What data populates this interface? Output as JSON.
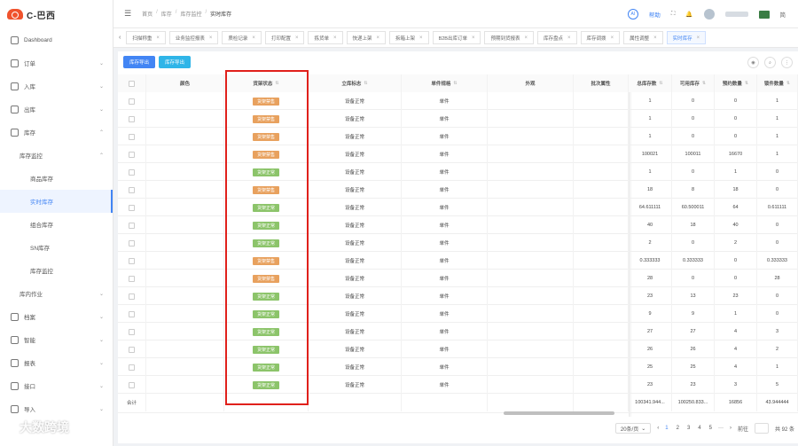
{
  "brand": {
    "name": "C-巴西"
  },
  "sidebar": {
    "items": [
      {
        "label": "Dashboard",
        "icon": "dashboard-icon",
        "chev": ""
      },
      {
        "label": "订单",
        "icon": "order-icon",
        "chev": "⌄"
      },
      {
        "label": "入库",
        "icon": "inbound-icon",
        "chev": "⌄"
      },
      {
        "label": "出库",
        "icon": "outbound-icon",
        "chev": "⌄"
      },
      {
        "label": "库存",
        "icon": "inventory-icon",
        "chev": "⌃"
      }
    ],
    "sub": {
      "label": "库存监控",
      "chev": "⌃"
    },
    "subitems": [
      "商品库存",
      "实时库存",
      "组合库存",
      "SN库存",
      "库存监控"
    ],
    "active_index": 1,
    "after_items": [
      {
        "label": "库内作业",
        "chev": "⌄",
        "kind": "sub"
      },
      {
        "label": "档案",
        "chev": "⌄",
        "icon": "archive-icon"
      },
      {
        "label": "智能",
        "chev": "⌄",
        "icon": "smart-icon"
      },
      {
        "label": "报表",
        "chev": "⌄",
        "icon": "report-icon"
      },
      {
        "label": "接口",
        "chev": "⌄",
        "icon": "api-icon"
      },
      {
        "label": "导入",
        "chev": "⌄",
        "icon": "import-icon"
      }
    ]
  },
  "topbar": {
    "breadcrumb": [
      "首页",
      "库存",
      "库存监控",
      "实时库存"
    ],
    "ai_label": "AI",
    "help_label": "帮助",
    "lang": "简"
  },
  "tabs": [
    "扫描称重",
    "业务监控报表",
    "质检记录",
    "打印配置",
    "拣货单",
    "快递上架",
    "拆箱上架",
    "B2B出库订单",
    "预期到货报表",
    "库存盘点",
    "库存调拨",
    "属性调整",
    "实时库存"
  ],
  "active_tab": 12,
  "toolbar": {
    "btn1": "库存导出",
    "btn2": "库存导出"
  },
  "columns": {
    "color": "颜色",
    "status": "货架状态",
    "mark": "立库标志",
    "sku": "单件规格",
    "ext": "外观",
    "batch": "批次属性",
    "total": "总库存数",
    "avail": "可用库存",
    "prebook": "预约数量",
    "lock": "锁件数量"
  },
  "rows": [
    {
      "status": "warn",
      "status_label": "货架禁售",
      "mark": "设备正常",
      "sku": "单件",
      "total": "1",
      "avail": "0",
      "prebook": "0",
      "lock": "1"
    },
    {
      "status": "warn",
      "status_label": "货架禁售",
      "mark": "设备正常",
      "sku": "单件",
      "total": "1",
      "avail": "0",
      "prebook": "0",
      "lock": "1"
    },
    {
      "status": "warn",
      "status_label": "货架禁售",
      "mark": "设备正常",
      "sku": "单件",
      "total": "1",
      "avail": "0",
      "prebook": "0",
      "lock": "1"
    },
    {
      "status": "warn",
      "status_label": "货架禁售",
      "mark": "设备正常",
      "sku": "单件",
      "total": "100021",
      "avail": "100011",
      "prebook": "16670",
      "lock": "1"
    },
    {
      "status": "ok",
      "status_label": "货架正常",
      "mark": "设备正常",
      "sku": "单件",
      "total": "1",
      "avail": "0",
      "prebook": "1",
      "lock": "0"
    },
    {
      "status": "warn",
      "status_label": "货架禁售",
      "mark": "设备正常",
      "sku": "单件",
      "total": "18",
      "avail": "8",
      "prebook": "18",
      "lock": "0"
    },
    {
      "status": "ok",
      "status_label": "货架正常",
      "mark": "设备正常",
      "sku": "单件",
      "total": "64.611111",
      "avail": "60.500011",
      "prebook": "64",
      "lock": "0.611111"
    },
    {
      "status": "ok",
      "status_label": "货架正常",
      "mark": "设备正常",
      "sku": "单件",
      "total": "40",
      "avail": "18",
      "prebook": "40",
      "lock": "0"
    },
    {
      "status": "ok",
      "status_label": "货架正常",
      "mark": "设备正常",
      "sku": "单件",
      "total": "2",
      "avail": "0",
      "prebook": "2",
      "lock": "0"
    },
    {
      "status": "warn",
      "status_label": "货架禁售",
      "mark": "设备正常",
      "sku": "单件",
      "total": "0.333333",
      "avail": "0.333333",
      "prebook": "0",
      "lock": "0.333333"
    },
    {
      "status": "warn",
      "status_label": "货架禁售",
      "mark": "设备正常",
      "sku": "单件",
      "total": "28",
      "avail": "0",
      "prebook": "0",
      "lock": "28"
    },
    {
      "status": "ok",
      "status_label": "货架正常",
      "mark": "设备正常",
      "sku": "单件",
      "total": "23",
      "avail": "13",
      "prebook": "23",
      "lock": "0"
    },
    {
      "status": "ok",
      "status_label": "货架正常",
      "mark": "设备正常",
      "sku": "单件",
      "total": "9",
      "avail": "9",
      "prebook": "1",
      "lock": "0"
    },
    {
      "status": "ok",
      "status_label": "货架正常",
      "mark": "设备正常",
      "sku": "单件",
      "total": "27",
      "avail": "27",
      "prebook": "4",
      "lock": "3"
    },
    {
      "status": "ok",
      "status_label": "货架正常",
      "mark": "设备正常",
      "sku": "单件",
      "total": "26",
      "avail": "26",
      "prebook": "4",
      "lock": "2"
    },
    {
      "status": "ok",
      "status_label": "货架正常",
      "mark": "设备正常",
      "sku": "单件",
      "total": "25",
      "avail": "25",
      "prebook": "4",
      "lock": "1"
    },
    {
      "status": "ok",
      "status_label": "货架正常",
      "mark": "设备正常",
      "sku": "单件",
      "total": "23",
      "avail": "23",
      "prebook": "3",
      "lock": "5"
    }
  ],
  "summary": {
    "label": "合计",
    "total": "100341.944...",
    "avail": "100250.833...",
    "prebook": "16856",
    "lock": "43.944444"
  },
  "pager": {
    "size": "20条/页",
    "pages": [
      "1",
      "2",
      "3",
      "4",
      "5"
    ],
    "current": "1",
    "goto_label": "前往",
    "total_label": "共 92 条"
  },
  "watermark": "大数跨境"
}
